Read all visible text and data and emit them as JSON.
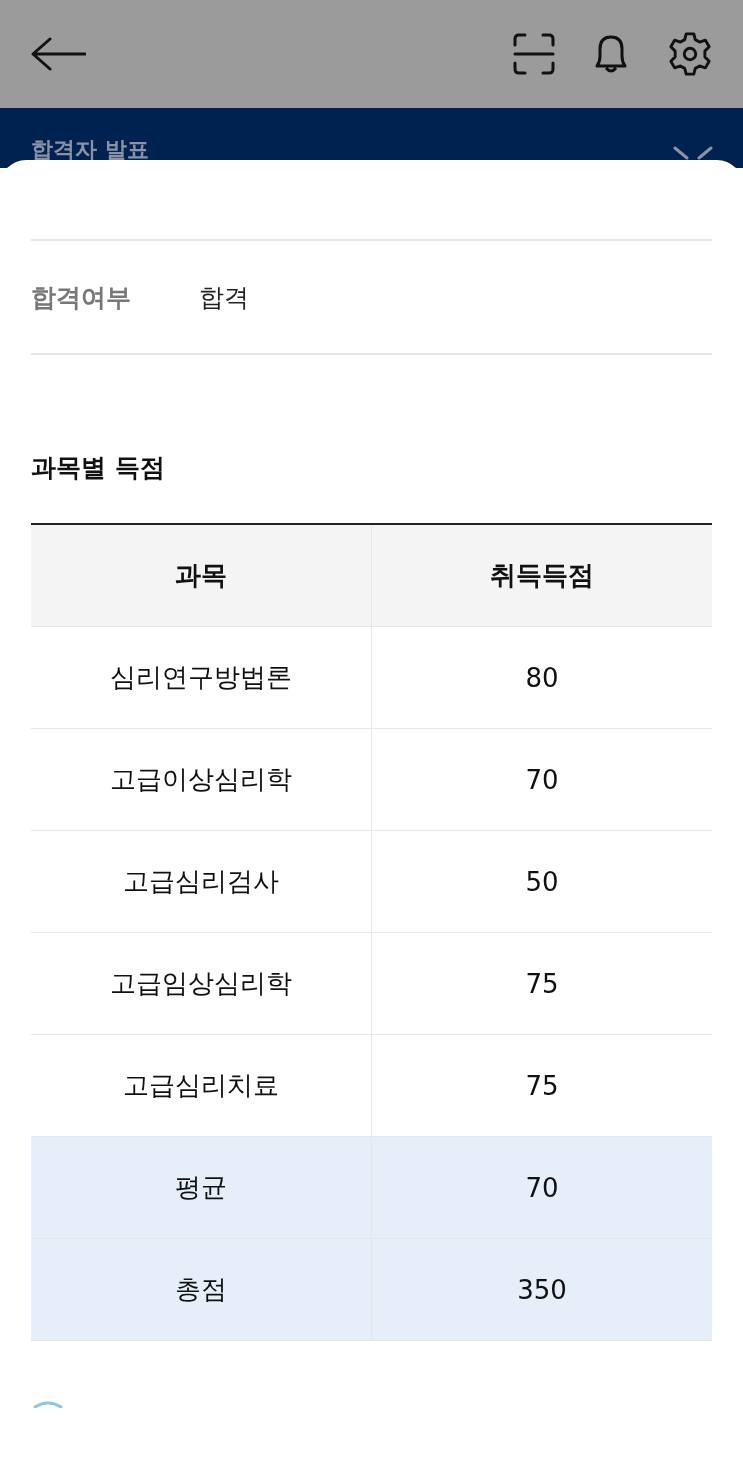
{
  "header": {
    "title": "합격자 발표"
  },
  "result": {
    "label": "합격여부",
    "value": "합격"
  },
  "scores": {
    "title": "과목별 득점",
    "columns": [
      "과목",
      "취득득점"
    ],
    "rows": [
      {
        "kind": "subject",
        "subject": "심리연구방법론",
        "score": "80"
      },
      {
        "kind": "subject",
        "subject": "고급이상심리학",
        "score": "70"
      },
      {
        "kind": "subject",
        "subject": "고급심리검사",
        "score": "50"
      },
      {
        "kind": "subject",
        "subject": "고급임상심리학",
        "score": "75"
      },
      {
        "kind": "subject",
        "subject": "고급심리치료",
        "score": "75"
      },
      {
        "kind": "summary",
        "subject": "평균",
        "score": "70"
      },
      {
        "kind": "summary",
        "subject": "총점",
        "score": "350"
      }
    ]
  }
}
